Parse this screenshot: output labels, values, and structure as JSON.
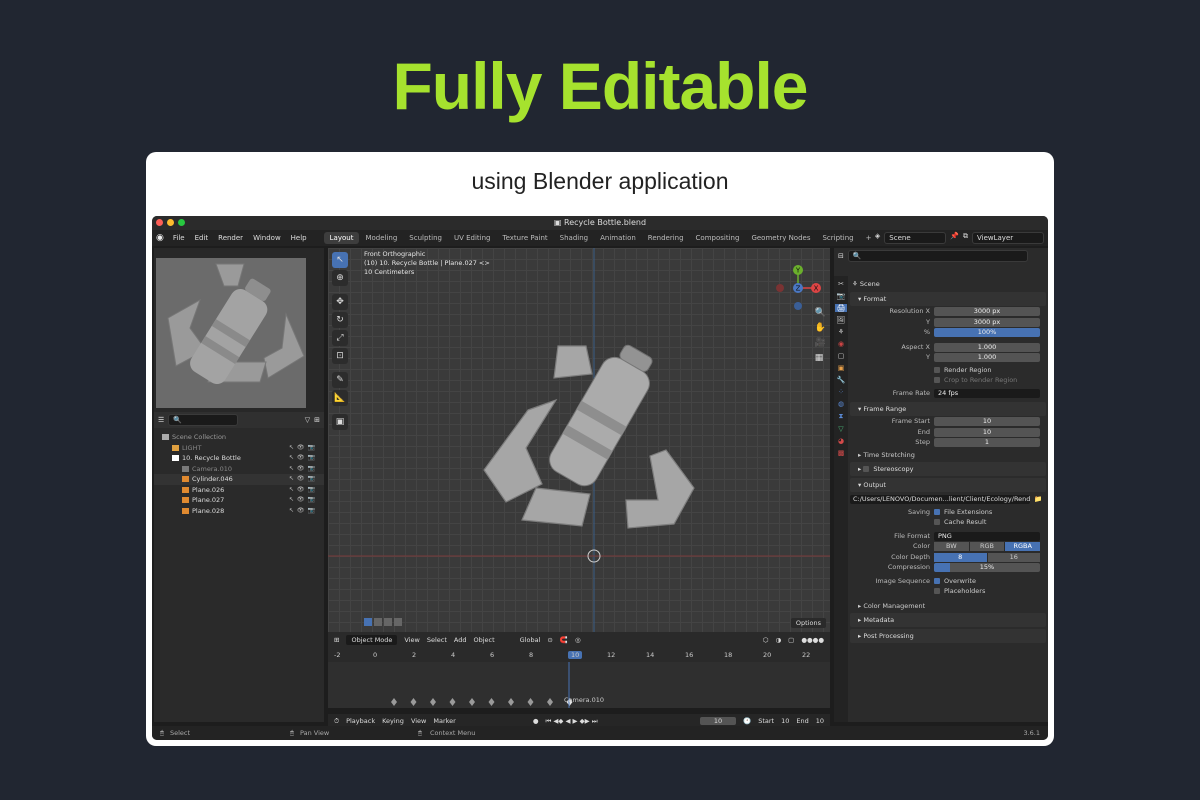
{
  "hero_title": "Fully Editable",
  "subtitle": "using Blender application",
  "window": {
    "title": "Recycle Bottle.blend"
  },
  "menu": [
    "File",
    "Edit",
    "Render",
    "Window",
    "Help"
  ],
  "workspaces": [
    "Layout",
    "Modeling",
    "Sculpting",
    "UV Editing",
    "Texture Paint",
    "Shading",
    "Animation",
    "Rendering",
    "Compositing",
    "Geometry Nodes",
    "Scripting",
    "+"
  ],
  "scene_name": "Scene",
  "viewlayer_name": "ViewLayer",
  "outliner": {
    "rows": [
      {
        "label": "Scene Collection",
        "indent": 0,
        "color": "#999"
      },
      {
        "label": "LIGHT",
        "indent": 1,
        "color": "#888"
      },
      {
        "label": "10. Recycle Bottle",
        "indent": 1,
        "color": "#ddd"
      },
      {
        "label": "Camera.010",
        "indent": 2,
        "color": "#888"
      },
      {
        "label": "Cylinder.046",
        "indent": 2,
        "color": "#ddd"
      },
      {
        "label": "Plane.026",
        "indent": 2,
        "color": "#ddd"
      },
      {
        "label": "Plane.027",
        "indent": 2,
        "color": "#ddd"
      },
      {
        "label": "Plane.028",
        "indent": 2,
        "color": "#ddd"
      }
    ]
  },
  "viewport": {
    "line1": "Front Orthographic",
    "line2": "(10) 10. Recycle Bottle | Plane.027 <>",
    "line3": "10 Centimeters",
    "options": "Options"
  },
  "viewport_toolbar": [
    "Object Mode",
    "View",
    "Select",
    "Add",
    "Object",
    "Global"
  ],
  "timeline": {
    "ticks": [
      "-2",
      "0",
      "2",
      "4",
      "6",
      "8",
      "10",
      "12",
      "14",
      "16",
      "18",
      "20",
      "22"
    ],
    "current": "10",
    "marker": "Camera.010"
  },
  "playback": {
    "items": [
      "Playback",
      "Keying",
      "View",
      "Marker"
    ],
    "frame": "10",
    "start_label": "Start",
    "start": "10",
    "end_label": "End",
    "end": "10"
  },
  "properties": {
    "scene": "Scene",
    "format": "Format",
    "res_x_label": "Resolution X",
    "res_x": "3000 px",
    "res_y_label": "Y",
    "res_y": "3000 px",
    "pct_label": "%",
    "pct": "100%",
    "asp_x_label": "Aspect X",
    "asp_x": "1.000",
    "asp_y_label": "Y",
    "asp_y": "1.000",
    "render_region": "Render Region",
    "crop_region": "Crop to Render Region",
    "fps_label": "Frame Rate",
    "fps": "24 fps",
    "frame_range": "Frame Range",
    "fstart_label": "Frame Start",
    "fstart": "10",
    "fend_label": "End",
    "fend": "10",
    "fstep_label": "Step",
    "fstep": "1",
    "time_stretching": "Time Stretching",
    "stereoscopy": "Stereoscopy",
    "output": "Output",
    "path": "C:/Users/LENOVO/Documen...lient/Client/Ecology/Render/",
    "saving_label": "Saving",
    "file_ext": "File Extensions",
    "cache": "Cache Result",
    "ffmt_label": "File Format",
    "ffmt": "PNG",
    "color_label": "Color",
    "color_opts": [
      "BW",
      "RGB",
      "RGBA"
    ],
    "depth_label": "Color Depth",
    "depth_opts": [
      "8",
      "16"
    ],
    "comp_label": "Compression",
    "comp": "15%",
    "compression_fraction": 0.15,
    "seq_label": "Image Sequence",
    "overwrite": "Overwrite",
    "placeholders": "Placeholders",
    "color_mgmt": "Color Management",
    "metadata": "Metadata",
    "post": "Post Processing"
  },
  "status": {
    "select": "Select",
    "pan": "Pan View",
    "ctx": "Context Menu",
    "version": "3.6.1"
  }
}
